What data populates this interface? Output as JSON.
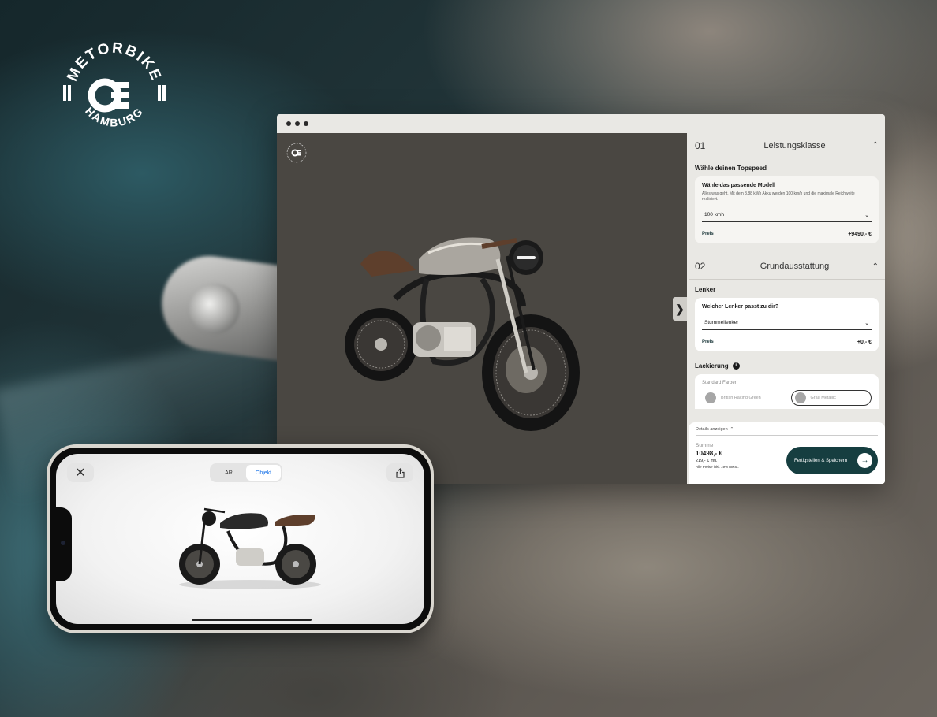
{
  "brand": {
    "logo_text_top": "METORBIKE",
    "logo_text_bottom": "HAMBURG",
    "logo_mark": "OE"
  },
  "browser": {
    "window_dots": [
      "dot",
      "dot",
      "dot"
    ],
    "toggle_icon": "chevron-right-icon",
    "toggle_glyph": "❯"
  },
  "configurator": {
    "section1": {
      "number": "01",
      "title": "Leistungsklasse",
      "subheading": "Wähle deinen Topspeed",
      "card_title": "Wähle das passende Modell",
      "card_desc": "Alles was geht. Mit dem 3,88 kWh Akku werden 100 km/h und die maximale Reichweite realisiert.",
      "select_value": "100 kmh",
      "price_label": "Preis",
      "price_value": "+9490,- €"
    },
    "section2": {
      "number": "02",
      "title": "Grundausstattung",
      "lenker_heading": "Lenker",
      "lenker_question": "Welcher Lenker passt zu dir?",
      "lenker_select": "Stummellenker",
      "lenker_price_label": "Preis",
      "lenker_price_value": "+0,- €",
      "paint_heading": "Lackierung",
      "paint_info": "i",
      "standard_colors_label": "Standard Farben",
      "color_options": [
        "British Racing Green",
        "Grau Metallic"
      ]
    },
    "footer": {
      "details_toggle": "Details anzeigen",
      "sum_label": "Summe",
      "sum_value": "10498,- €",
      "monthly": "219,- € mtl.",
      "vat_note": "Alle Preise inkl. 19% MwSt.",
      "finish_button": "Fertigstellen & Speichern",
      "finish_icon": "arrow-right-icon"
    },
    "chevron_glyph": "⌃",
    "select_glyph": "⌄"
  },
  "phone": {
    "close_glyph": "✕",
    "segment_options": [
      "AR",
      "Objekt"
    ],
    "active_segment": "Objekt",
    "share_icon": "share-icon"
  },
  "colors": {
    "accent_dark_teal": "#163e40",
    "panel_bg": "#e9e8e4",
    "viewport_bg": "#4a4742",
    "active_segment_text": "#1a73e8"
  }
}
